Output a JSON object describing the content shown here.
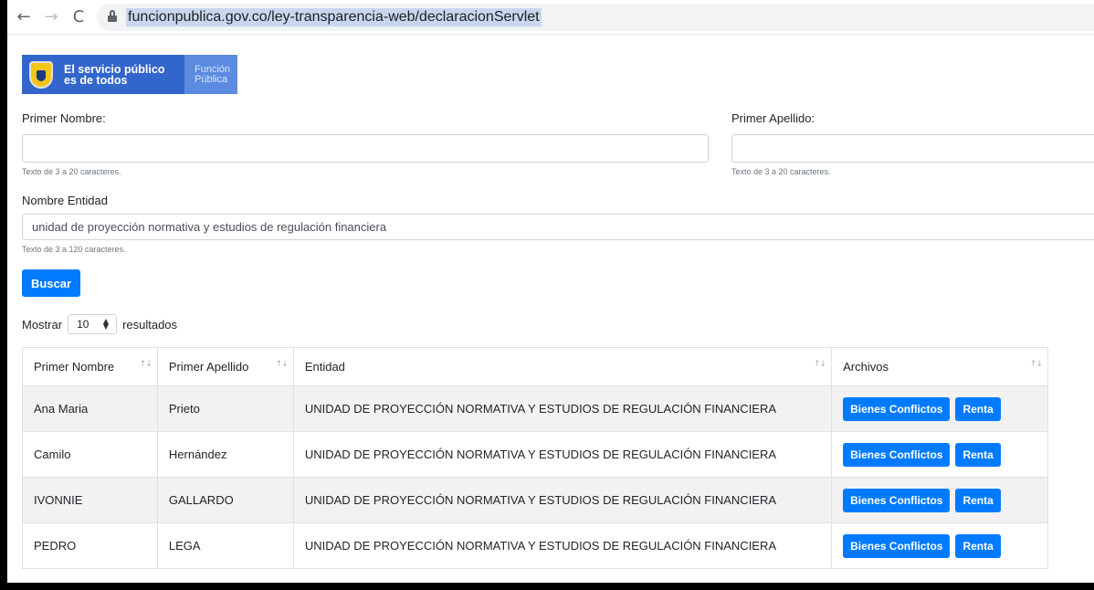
{
  "browser": {
    "back_icon": "←",
    "forward_icon": "→",
    "reload_icon": "C",
    "url": "funcionpublica.gov.co/ley-transparencia-web/declaracionServlet"
  },
  "logo": {
    "line1": "El servicio público",
    "line2": "es de todos",
    "fp_line1": "Función",
    "fp_line2": "Pública"
  },
  "form": {
    "first_name_label": "Primer Nombre:",
    "first_name_value": "",
    "first_name_help": "Texto de 3 a 20 caracteres.",
    "last_name_label": "Primer Apellido:",
    "last_name_value": "",
    "last_name_help": "Texto de 3 a 20 caracteres.",
    "entity_label": "Nombre Entidad",
    "entity_value": "unidad de proyección normativa y estudios de regulación financiera",
    "entity_help": "Texto de 3 a 120 caracteres.",
    "search_label": "Buscar"
  },
  "length_control": {
    "prefix": "Mostrar",
    "value": "10",
    "suffix": "resultados"
  },
  "table": {
    "headers": [
      "Primer Nombre",
      "Primer Apellido",
      "Entidad",
      "Archivos"
    ],
    "sort_icon": "↑↓",
    "button_bienes": "Bienes Conflictos",
    "button_renta": "Renta",
    "rows": [
      {
        "nombre": "Ana Maria",
        "apellido": "Prieto",
        "entidad": "UNIDAD DE PROYECCIÓN NORMATIVA Y ESTUDIOS DE REGULACIÓN FINANCIERA"
      },
      {
        "nombre": "Camilo",
        "apellido": "Hernández",
        "entidad": "UNIDAD DE PROYECCIÓN NORMATIVA Y ESTUDIOS DE REGULACIÓN FINANCIERA"
      },
      {
        "nombre": "IVONNIE",
        "apellido": "GALLARDO",
        "entidad": "UNIDAD DE PROYECCIÓN NORMATIVA Y ESTUDIOS DE REGULACIÓN FINANCIERA"
      },
      {
        "nombre": "PEDRO",
        "apellido": "LEGA",
        "entidad": "UNIDAD DE PROYECCIÓN NORMATIVA Y ESTUDIOS DE REGULACIÓN FINANCIERA"
      }
    ]
  },
  "colors": {
    "primary": "#007bff",
    "brand_blue": "#3366cc",
    "stripe": "#f2f2f2"
  }
}
